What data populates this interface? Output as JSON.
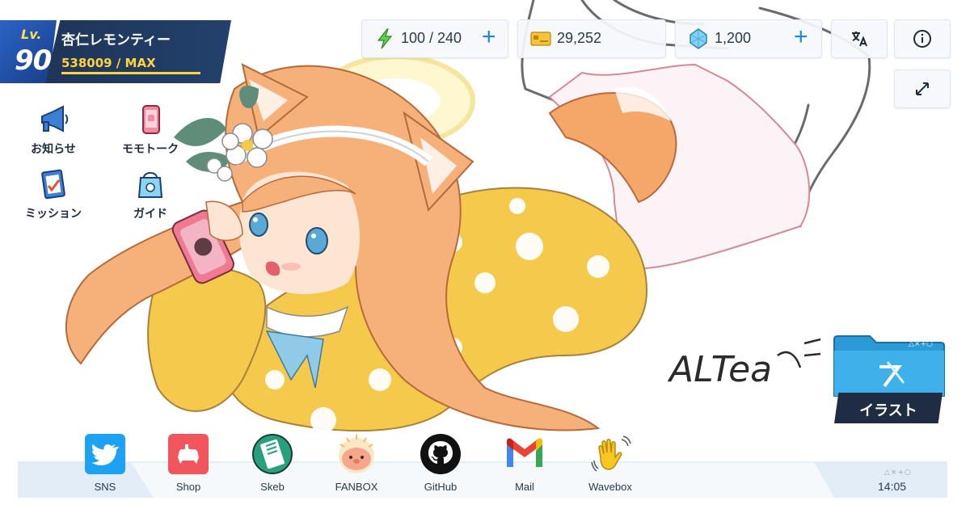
{
  "player": {
    "level_label": "Lv.",
    "level": "90",
    "name": "杏仁レモンティー",
    "exp_text": "538009 / MAX",
    "exp_progress": 1.0
  },
  "resources": {
    "stamina": {
      "icon": "lightning-icon",
      "value": "100 / 240"
    },
    "credits": {
      "icon": "credit-card-icon",
      "value": "29,252"
    },
    "gems": {
      "icon": "gem-icon",
      "value": "1,200"
    }
  },
  "top_buttons": [
    "translate-icon",
    "info-icon",
    "expand-icon"
  ],
  "menu": [
    {
      "id": "notice",
      "label": "お知らせ",
      "icon": "megaphone-icon"
    },
    {
      "id": "momotalk",
      "label": "モモトーク",
      "icon": "smartphone-icon"
    },
    {
      "id": "mission",
      "label": "ミッション",
      "icon": "clipboard-icon"
    },
    {
      "id": "guide",
      "label": "ガイド",
      "icon": "guide-bag-icon"
    }
  ],
  "signature": "ALTea",
  "folder": {
    "label": "イラスト",
    "icon": "folder-icon",
    "deco": "△×+○"
  },
  "dock": [
    {
      "label": "SNS",
      "icon": "twitter-bird-icon",
      "color": "#1da1f2"
    },
    {
      "label": "Shop",
      "icon": "shop-icon",
      "color": "#f0565c"
    },
    {
      "label": "Skeb",
      "icon": "skeb-icon",
      "color": "#28a07d"
    },
    {
      "label": "FANBOX",
      "icon": "fanbox-icon",
      "color": "#f6a68a"
    },
    {
      "label": "GitHub",
      "icon": "github-icon",
      "color": "#111111"
    },
    {
      "label": "Mail",
      "icon": "gmail-icon",
      "color": "#ea4335"
    },
    {
      "label": "Wavebox",
      "icon": "waving-hand-icon",
      "color": "#f9c623"
    }
  ],
  "clock": {
    "deco": "△×+○",
    "time": "14:05"
  },
  "colors": {
    "accent": "#1f84d6",
    "navy": "#1f3558",
    "gold": "#ffd43c"
  }
}
